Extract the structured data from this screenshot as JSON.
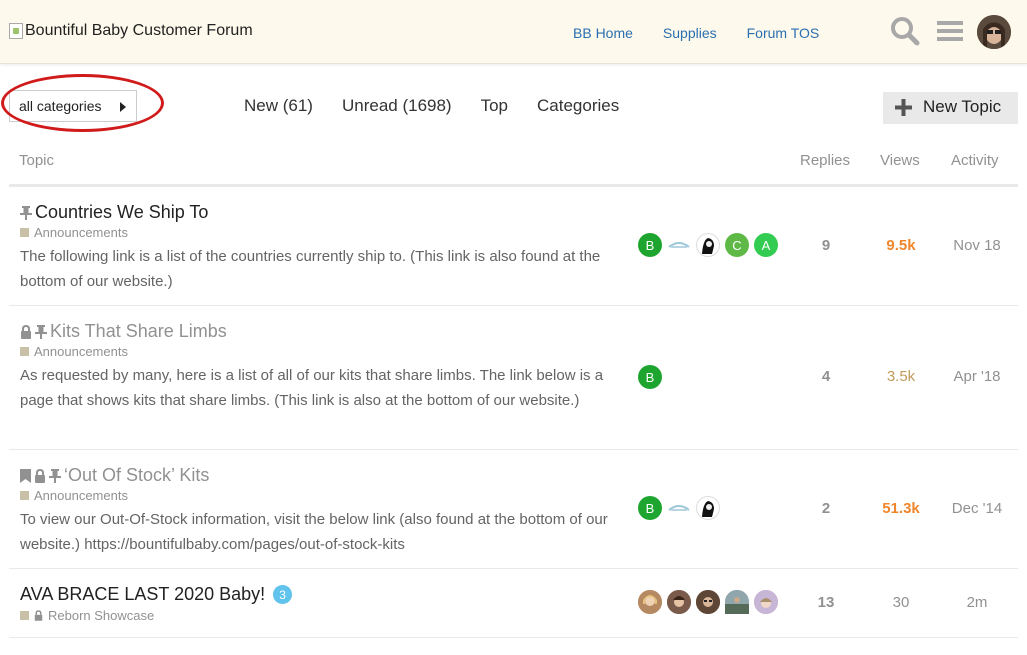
{
  "header": {
    "logo_alt": "Bountiful Baby Customer Forum",
    "nav": [
      "BB Home",
      "Supplies",
      "Forum TOS"
    ]
  },
  "nav": {
    "category_dropdown": "all categories",
    "pills": [
      "New (61)",
      "Unread (1698)",
      "Top",
      "Categories"
    ],
    "new_topic": "New Topic"
  },
  "table_headers": {
    "topic": "Topic",
    "replies": "Replies",
    "views": "Views",
    "activity": "Activity"
  },
  "colors": {
    "link": "#2a6fb0",
    "header_bg": "#fdf9ec",
    "hot_views": "#f0862b",
    "category": "#c9c0a8",
    "badge": "#5fc3ec",
    "annotation": "#d11a1a"
  },
  "topics": [
    {
      "title": "Countries We Ship To",
      "category": "Announcements",
      "excerpt": "The following link is a list of the countries currently ship to. (This link is also found at the bottom of our website.)",
      "posters": [
        "B",
        "",
        "",
        "C",
        "A"
      ],
      "replies": "9",
      "views": "9.5k",
      "activity": "Nov 18"
    },
    {
      "title": "Kits That Share Limbs",
      "category": "Announcements",
      "excerpt": "As requested by many, here is a list of all of our kits that share limbs. The link below is a page that shows kits that share limbs. (This link is also at the bottom of our website.)",
      "posters": [
        "B"
      ],
      "replies": "4",
      "views": "3.5k",
      "activity": "Apr '18"
    },
    {
      "title": "‘Out Of Stock’ Kits",
      "category": "Announcements",
      "excerpt": "To view our Out-Of-Stock information, visit the below link (also found at the bottom of our website.) https://bountifulbaby.com/pages/out-of-stock-kits",
      "posters": [
        "B",
        "",
        ""
      ],
      "replies": "2",
      "views": "51.3k",
      "activity": "Dec '14"
    },
    {
      "title": "AVA BRACE LAST 2020 Baby!",
      "badge": "3",
      "category": "Reborn Showcase",
      "posters": [
        "",
        "",
        "",
        "",
        ""
      ],
      "replies": "13",
      "views": "30",
      "activity": "2m"
    }
  ]
}
